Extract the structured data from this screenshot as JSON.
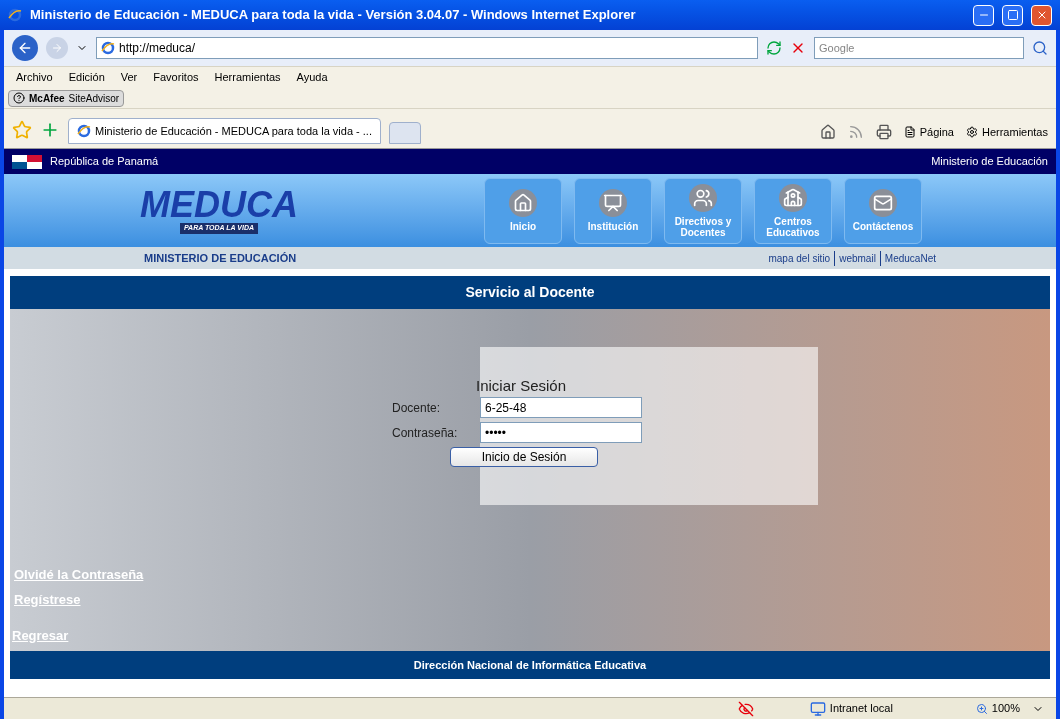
{
  "window": {
    "title": "Ministerio de Educación - MEDUCA para toda la vida - Versión 3.04.07 - Windows Internet Explorer"
  },
  "address_bar": {
    "url": "http://meduca/",
    "search_placeholder": "Google"
  },
  "menu": [
    "Archivo",
    "Edición",
    "Ver",
    "Favoritos",
    "Herramientas",
    "Ayuda"
  ],
  "addon": {
    "label": "McAfee",
    "sublabel": "SiteAdvisor"
  },
  "tabs": [
    {
      "label": "Ministerio de Educación - MEDUCA para toda la vida - ...",
      "selected": true
    }
  ],
  "command_bar": [
    "Página",
    "Herramientas"
  ],
  "page": {
    "top_left": "República de Panamá",
    "top_right": "Ministerio de Educación",
    "logo": {
      "name": "MEDUCA",
      "tagline": "PARA TODA LA VIDA"
    },
    "nav": [
      {
        "kind": "home",
        "label": "Inicio"
      },
      {
        "kind": "building",
        "label": "Institución"
      },
      {
        "kind": "people",
        "label": "Directivos y Docentes"
      },
      {
        "kind": "school",
        "label": "Centros Educativos"
      },
      {
        "kind": "mail",
        "label": "Contáctenos"
      }
    ],
    "subbar_left": "MINISTERIO DE EDUCACIÓN",
    "subbar_links": [
      "mapa del sitio",
      "webmail",
      "MeducaNet"
    ],
    "section_title": "Servicio al Docente",
    "login": {
      "title": "Iniciar Sesión",
      "fields": [
        {
          "label": "Docente:",
          "value": "6-25-48"
        },
        {
          "label": "Contraseña:",
          "value": "•••••"
        }
      ],
      "button": "Inicio de  Sesión"
    },
    "links": [
      "Olvidé la Contraseña",
      "Regístrese"
    ],
    "back_link": "Regresar",
    "footer": "Dirección Nacional de Informática Educativa"
  },
  "status_bar": {
    "zone": "Intranet local",
    "zoom": "100%"
  }
}
